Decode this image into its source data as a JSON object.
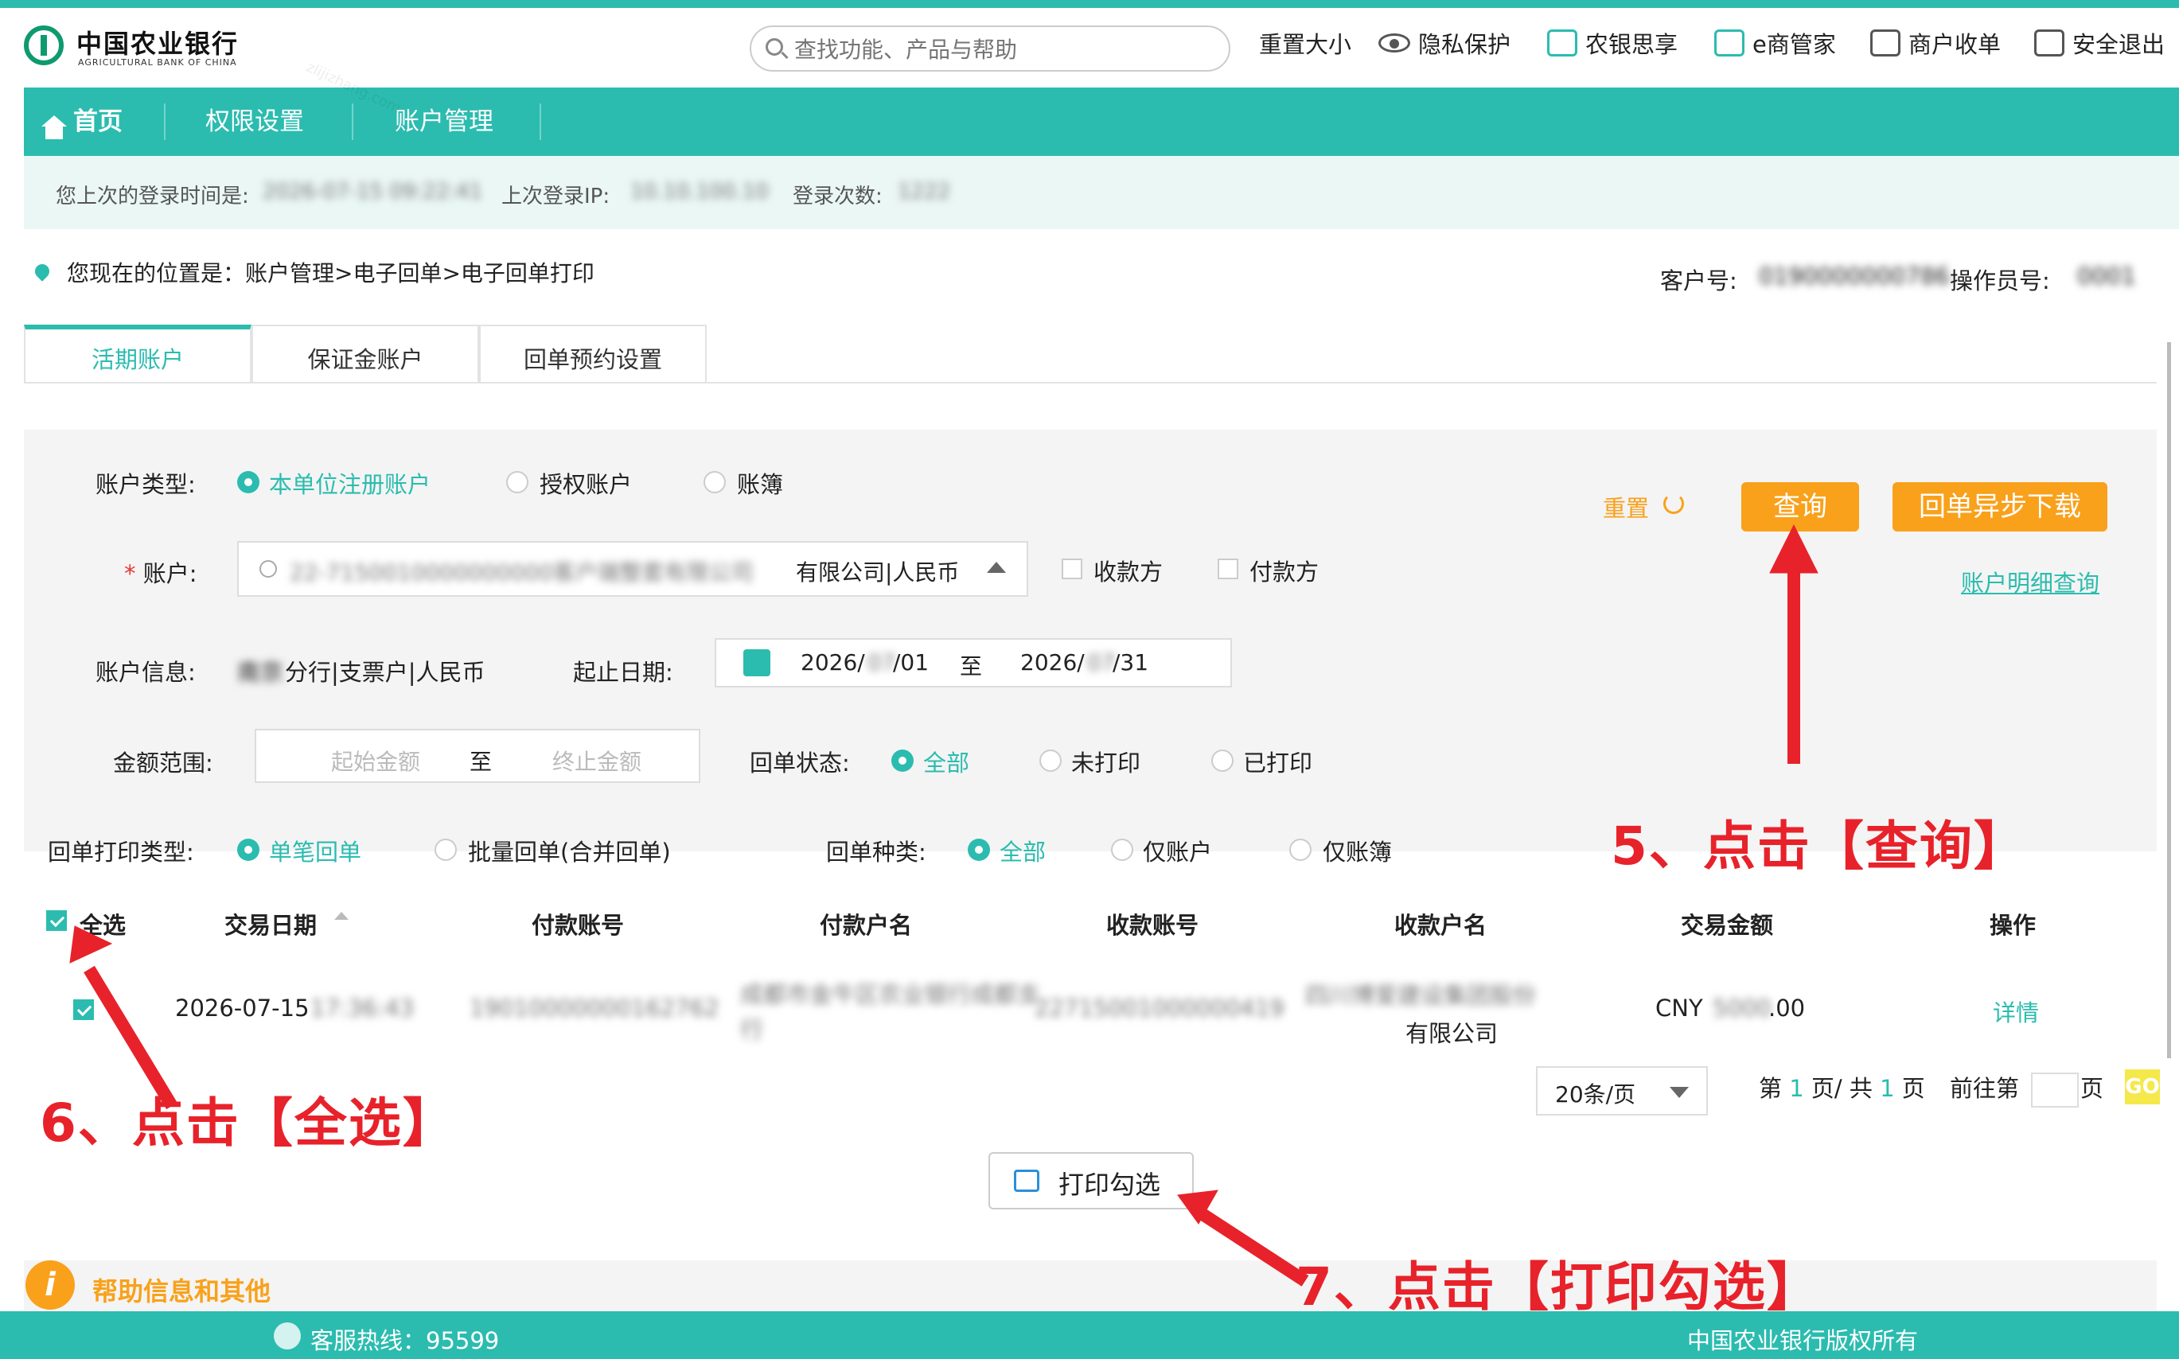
{
  "brand": {
    "name_cn": "中国农业银行",
    "name_en": "AGRICULTURAL BANK OF CHINA"
  },
  "search": {
    "placeholder": "查找功能、产品与帮助"
  },
  "top_links": [
    {
      "label": "重置大小",
      "icon": "resize-icon"
    },
    {
      "label": "隐私保护",
      "icon": "eye-icon"
    },
    {
      "label": "农银思享",
      "icon": "monitor-icon"
    },
    {
      "label": "e商管家",
      "icon": "shop-icon"
    },
    {
      "label": "商户收单",
      "icon": "receipt-icon"
    },
    {
      "label": "安全退出",
      "icon": "exit-icon"
    }
  ],
  "nav": {
    "home": "首页",
    "items": [
      "权限设置",
      "账户管理"
    ]
  },
  "login": {
    "last_time_label": "您上次的登录时间是:",
    "last_time": "2026-07-15 09:22:41",
    "last_ip_label": "上次登录IP:",
    "last_ip": "10.10.100.10",
    "count_label": "登录次数:",
    "count": "1222"
  },
  "location": {
    "text": "您现在的位置是：账户管理>电子回单>电子回单打印"
  },
  "customer": {
    "cust_label": "客户号:",
    "cust_no": "0190000000786",
    "op_label": "操作员号:",
    "op_no": "0001"
  },
  "tabs": [
    "活期账户",
    "保证金账户",
    "回单预约设置"
  ],
  "form": {
    "account_type_label": "账户类型:",
    "account_types": [
      "本单位注册账户",
      "授权账户",
      "账簿"
    ],
    "account_label": "账户:",
    "account_value_blur": "22-7150010000000000客户端整套有限公司",
    "account_value_tail": "有限公司|人民币",
    "payee": "收款方",
    "payer": "付款方",
    "account_info_label": "账户信息:",
    "account_info_blur": "南京",
    "account_info_tail": "分行|支票户|人民币",
    "date_label": "起止日期:",
    "date_from_a": "2026/",
    "date_from_blur": "07",
    "date_from_b": "/01",
    "date_sep": "至",
    "date_to_a": "2026/",
    "date_to_blur": "07",
    "date_to_b": "/31",
    "amount_label": "金额范围:",
    "amount_from_ph": "起始金额",
    "amount_sep": "至",
    "amount_to_ph": "终止金额",
    "status_label": "回单状态:",
    "statuses": [
      "全部",
      "未打印",
      "已打印"
    ],
    "print_type_label": "回单打印类型:",
    "print_types": [
      "单笔回单",
      "批量回单(合并回单)"
    ],
    "kind_label": "回单种类:",
    "kinds": [
      "全部",
      "仅账户",
      "仅账簿"
    ],
    "reset": "重置",
    "query": "查询",
    "async_download": "回单异步下载",
    "detail_query": "账户明细查询"
  },
  "table": {
    "headers": [
      "全选",
      "交易日期",
      "付款账号",
      "付款户名",
      "收款账号",
      "收款户名",
      "交易金额",
      "操作"
    ],
    "rows": [
      {
        "date": "2026-07-15",
        "time_blur": "17:36:43",
        "payer_acct_blur": "19010000000162762",
        "payer_name_blur": "成都市金牛区农业银行成都支行",
        "payee_acct_blur": "22715001000000419",
        "payee_name_blur": "四川博爱建设集团股份",
        "payee_name_tail": "有限公司",
        "amount_a": "CNY",
        "amount_blur": "5000",
        "amount_b": ".00",
        "action": "详情"
      }
    ]
  },
  "pager": {
    "size": "20条/页",
    "page_prefix": "第",
    "page_cur": "1",
    "page_mid": "页/ 共",
    "page_total": "1",
    "page_suffix": "页",
    "goto_prefix": "前往第",
    "goto_suffix": "页",
    "go": "GO"
  },
  "print_btn": "打印勾选",
  "help": "帮助信息和其他",
  "footer": {
    "hotline": "客服热线：95599",
    "copyright": "中国农业银行版权所有"
  },
  "annotations": {
    "step5": "5、点击【查询】",
    "step6": "6、点击【全选】",
    "step7": "7、点击【打印勾选】"
  },
  "watermark": "zlijizhang.com",
  "colors": {
    "teal": "#2bbcaf",
    "orange": "#f9a11b",
    "annotation": "#e8222a"
  }
}
